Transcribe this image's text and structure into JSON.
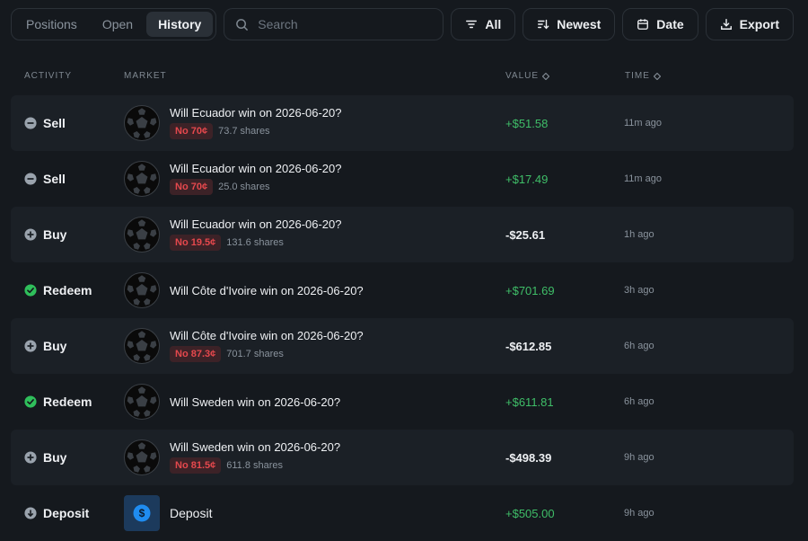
{
  "colors": {
    "background": "#15191e",
    "row_alt": "#1b2026",
    "positive": "#3fbe68",
    "badge_text": "#e5484d",
    "badge_bg": "#3c2227",
    "redeem_icon": "#2fbf5b",
    "deposit_bg": "#1c3a5c",
    "deposit_coin": "#1f8cf0"
  },
  "tabs": [
    {
      "label": "Positions",
      "active": false
    },
    {
      "label": "Open",
      "active": false
    },
    {
      "label": "History",
      "active": true
    }
  ],
  "search": {
    "placeholder": "Search",
    "value": "",
    "icon": "search-icon"
  },
  "buttons": {
    "filter": {
      "label": "All",
      "icon": "filter-icon"
    },
    "sort": {
      "label": "Newest",
      "icon": "sort-icon"
    },
    "date": {
      "label": "Date",
      "icon": "calendar-icon"
    },
    "export": {
      "label": "Export",
      "icon": "download-icon"
    }
  },
  "table": {
    "columns": {
      "activity": "ACTIVITY",
      "market": "MARKET",
      "value": "VALUE",
      "time": "TIME"
    },
    "rows": [
      {
        "activity": "Sell",
        "icon": "minus-circle-icon",
        "market": "Will Ecuador win on 2026-06-20?",
        "badge": "No 70¢",
        "shares": "73.7 shares",
        "value": "+$51.58",
        "sign": "pos",
        "time": "11m ago"
      },
      {
        "activity": "Sell",
        "icon": "minus-circle-icon",
        "market": "Will Ecuador win on 2026-06-20?",
        "badge": "No 70¢",
        "shares": "25.0 shares",
        "value": "+$17.49",
        "sign": "pos",
        "time": "11m ago"
      },
      {
        "activity": "Buy",
        "icon": "plus-circle-icon",
        "market": "Will Ecuador win on 2026-06-20?",
        "badge": "No 19.5¢",
        "shares": "131.6 shares",
        "value": "-$25.61",
        "sign": "neg",
        "time": "1h ago"
      },
      {
        "activity": "Redeem",
        "icon": "check-circle-icon",
        "market": "Will Côte d'Ivoire win on 2026-06-20?",
        "badge": "",
        "shares": "",
        "value": "+$701.69",
        "sign": "pos",
        "time": "3h ago"
      },
      {
        "activity": "Buy",
        "icon": "plus-circle-icon",
        "market": "Will Côte d'Ivoire win on 2026-06-20?",
        "badge": "No 87.3¢",
        "shares": "701.7 shares",
        "value": "-$612.85",
        "sign": "neg",
        "time": "6h ago"
      },
      {
        "activity": "Redeem",
        "icon": "check-circle-icon",
        "market": "Will Sweden win on 2026-06-20?",
        "badge": "",
        "shares": "",
        "value": "+$611.81",
        "sign": "pos",
        "time": "6h ago"
      },
      {
        "activity": "Buy",
        "icon": "plus-circle-icon",
        "market": "Will Sweden win on 2026-06-20?",
        "badge": "No 81.5¢",
        "shares": "611.8 shares",
        "value": "-$498.39",
        "sign": "neg",
        "time": "9h ago"
      },
      {
        "activity": "Deposit",
        "icon": "arrow-down-circle-icon",
        "market": "Deposit",
        "badge": "",
        "shares": "",
        "value": "+$505.00",
        "sign": "pos",
        "time": "9h ago"
      }
    ]
  }
}
